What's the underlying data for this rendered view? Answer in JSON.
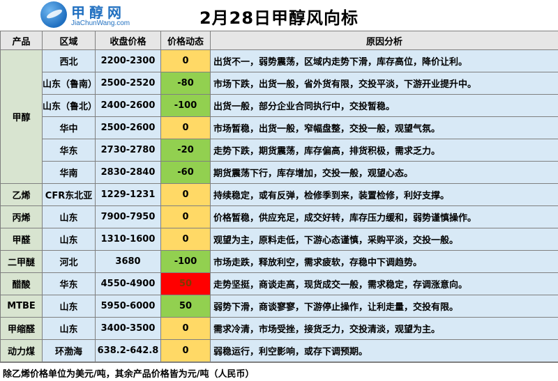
{
  "logo": {
    "cn": "甲醇网",
    "en": "JiaChunWang.com"
  },
  "title": "2月28日甲醇风向标",
  "headers": [
    "产品",
    "区域",
    "收盘价格",
    "价格动态",
    "原因分析"
  ],
  "methanol_label": "甲醇",
  "methanol_rows": [
    {
      "region": "西北",
      "price": "2200-2300",
      "change": "0",
      "reason": "出货不一，弱势震荡，区域内走势下滑，库存高位，降价让利。"
    },
    {
      "region": "山东（鲁南）",
      "price": "2500-2520",
      "change": "-80",
      "reason": "市场下跌，出货一般，省外货有限，交投平淡，下游开业提升中。"
    },
    {
      "region": "山东（鲁北）",
      "price": "2400-2600",
      "change": "-100",
      "reason": "出货一般，部分企业合同执行中，交投暂稳。"
    },
    {
      "region": "华中",
      "price": "2500-2600",
      "change": "0",
      "reason": "市场暂稳，出货一般，窄幅盘整，交投一般，观望气氛。"
    },
    {
      "region": "华东",
      "price": "2730-2780",
      "change": "-20",
      "reason": "走势下跌，期货震荡，库存偏高，排货积极，需求乏力。"
    },
    {
      "region": "华南",
      "price": "2830-2840",
      "change": "-60",
      "reason": "期货震荡下行，库存增加，交投一般，观望心态。"
    }
  ],
  "other_rows": [
    {
      "product": "乙烯",
      "region": "CFR东北亚",
      "price": "1229-1231",
      "change": "0",
      "reason": "持续稳定，或有反弹，检修季到来，装置检修，利好支撑。"
    },
    {
      "product": "丙烯",
      "region": "山东",
      "price": "7900-7950",
      "change": "0",
      "reason": "价格暂稳，供应充足，成交好转，库存压力缓和，弱势谨慎操作。"
    },
    {
      "product": "甲醛",
      "region": "山东",
      "price": "1310-1600",
      "change": "0",
      "reason": "观望为主，原料走低，下游心态谨慎，采购平淡，交投一般。"
    },
    {
      "product": "二甲醚",
      "region": "河北",
      "price": "3680",
      "change": "-100",
      "reason": "市场走跌，释放利空，需求疲软，存稳中下调趋势。"
    },
    {
      "product": "醋酸",
      "region": "华东",
      "price": "4550-4900",
      "change": "50",
      "reason": "走势坚挺，商谈走高，现货成交一般，需求稳定，存调涨意向。"
    },
    {
      "product": "MTBE",
      "region": "山东",
      "price": "5950-6000",
      "change": "50",
      "reason": "弱势下滑，商谈寥寥，下游停止操作，让利走量，交投有限。"
    },
    {
      "product": "甲缩醛",
      "region": "山东",
      "price": "3400-3500",
      "change": "0",
      "reason": "需求冷清，市场受挫，接货乏力，交投清淡，观望为主。"
    },
    {
      "product": "动力煤",
      "region": "环渤海",
      "price": "638.2-642.8",
      "change": "0",
      "reason": "弱稳运行，利空影响，或存下调预期。"
    }
  ],
  "footer": "除乙烯价格单位为美元/吨，其余产品价格皆为元/吨（人民币）",
  "colors": {
    "zero": "#ffd966",
    "down": "#92d050",
    "up_red": "#ff0000",
    "blue_cell": "#d8e9f6",
    "green_cell": "#d8e4d0"
  }
}
